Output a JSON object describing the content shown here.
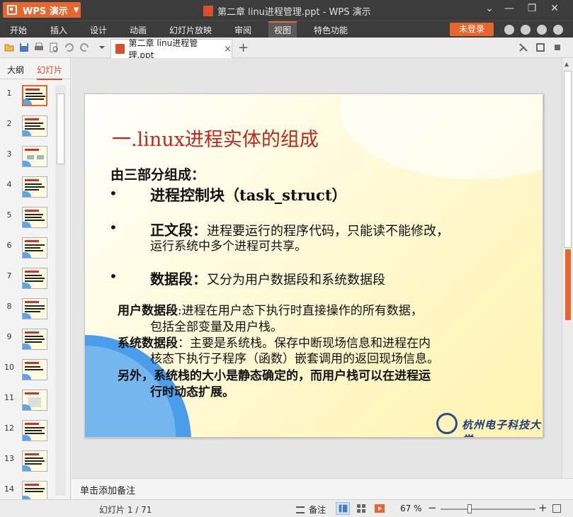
{
  "app": {
    "name": "WPS 演示",
    "document_title": "第二章 linu进程管理.ppt - WPS 演示"
  },
  "menu": {
    "items": [
      "开始",
      "插入",
      "设计",
      "动画",
      "幻灯片放映",
      "审阅",
      "视图",
      "特色功能"
    ],
    "active": "视图",
    "login_label": "未登录"
  },
  "tab": {
    "label": "第二章 linu进程管理.ppt",
    "close": "×",
    "new": "+"
  },
  "panel": {
    "tabs": [
      "大纲",
      "幻灯片"
    ],
    "active_tab": "幻灯片",
    "slide_numbers": [
      "1",
      "2",
      "3",
      "4",
      "5",
      "6",
      "7",
      "8",
      "9",
      "10",
      "11",
      "12",
      "13",
      "14"
    ],
    "selected": "1"
  },
  "slide": {
    "title": "一.linux进程实体的组成",
    "subtitle": "由三部分组成：",
    "bullet_marker": "•",
    "bullet1": "进程控制块（task_struct）",
    "bullet2_head": "正文段：",
    "bullet2_text": "进程要运行的程序代码，只能读不能修改，",
    "bullet2_text2": "运行系统中多个进程可共享。",
    "bullet3_head": "数据段：",
    "bullet3_text": "又分为用户数据段和系统数据段",
    "para1_head": "用户数据段",
    "para1_text": ":进程在用户态下执行时直接操作的所有数据，",
    "para1_text2": "包括全部变量及用户栈。",
    "para2_head": "系统数据段",
    "para2_text": "：主要是系统栈。保存中断现场信息和进程在内",
    "para2_text2": "核态下执行子程序（函数）嵌套调用的返回现场信息。",
    "para3_text": "另外，系统栈的大小是静态确定的，而用户栈可以在进程运",
    "para3_text2": "行时动态扩展。",
    "university": "杭州电子科技大学"
  },
  "notes": {
    "placeholder": "单击添加备注"
  },
  "status": {
    "slide_count": "幻灯片 1 / 71",
    "notes_label": "备注",
    "zoom": "67 %",
    "zoom_minus": "−",
    "zoom_plus": "+"
  },
  "colors": {
    "accent": "#e8662b",
    "titlebar": "#3c3c3c",
    "slide_title": "#c0281e"
  }
}
